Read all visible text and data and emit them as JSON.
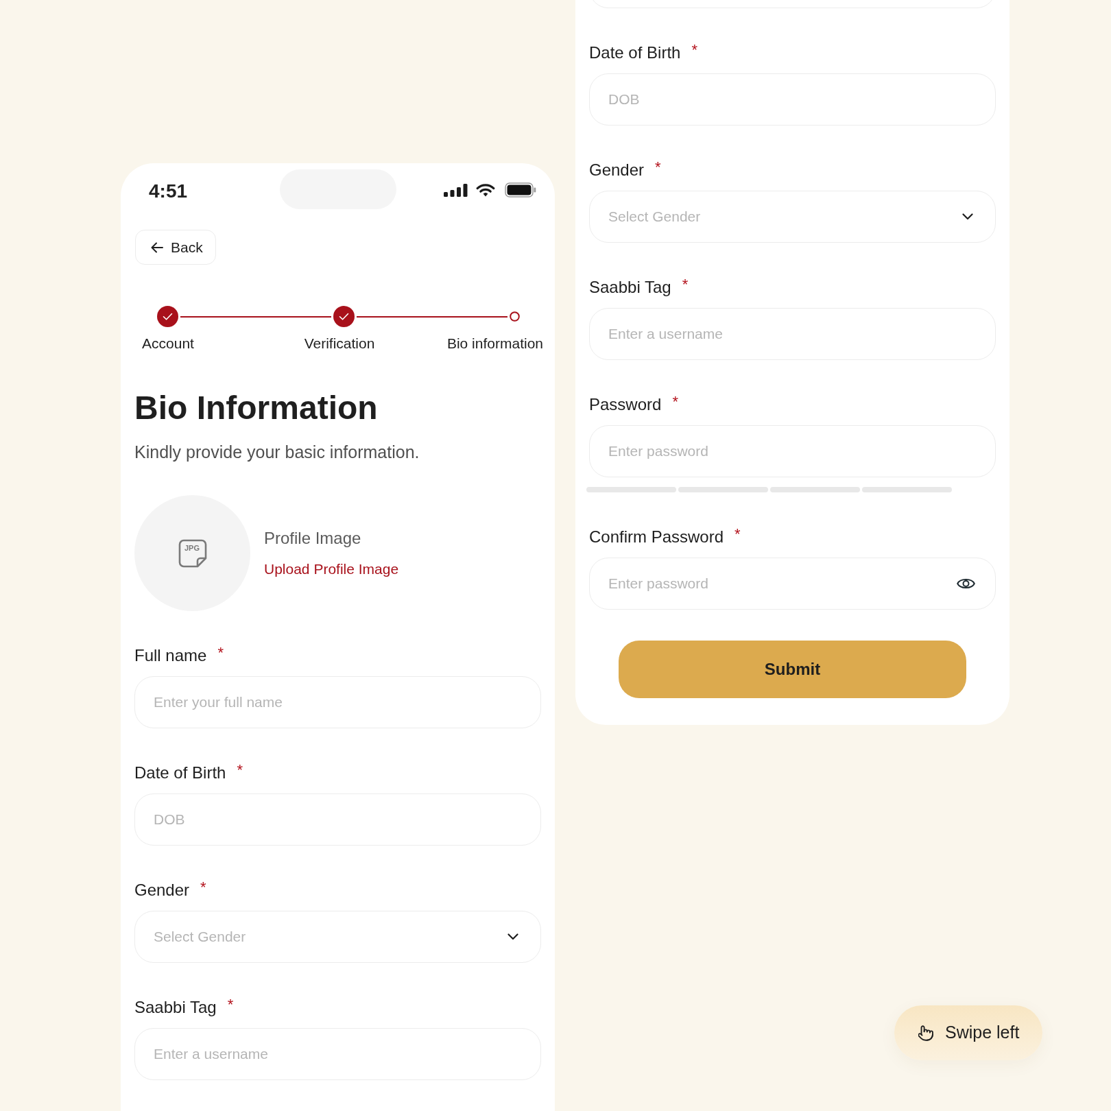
{
  "phone": {
    "status_bar": {
      "time": "4:51"
    },
    "back_button": {
      "label": "Back"
    },
    "steps": [
      {
        "label": "Account",
        "done": true
      },
      {
        "label": "Verification",
        "done": true
      },
      {
        "label": "Bio information",
        "done": false
      }
    ],
    "title": "Bio Information",
    "subtitle": "Kindly provide your basic information.",
    "profile_image": {
      "icon_text": "JPG",
      "label": "Profile Image",
      "link": "Upload Profile Image"
    },
    "fields": [
      {
        "label": "Full name",
        "asterisk": "*",
        "kind": "text",
        "placeholder": "Enter your full name"
      },
      {
        "label": "Date of Birth",
        "asterisk": "*",
        "kind": "text",
        "placeholder": "DOB"
      },
      {
        "label": "Gender",
        "asterisk": "*",
        "kind": "select",
        "placeholder": "Select Gender"
      },
      {
        "label": "Saabbi Tag",
        "asterisk": "*",
        "kind": "text",
        "placeholder": "Enter a username"
      }
    ]
  },
  "continued_screen": {
    "fields": [
      {
        "label": "Date of Birth",
        "asterisk": "*",
        "kind": "text",
        "placeholder": "DOB"
      },
      {
        "label": "Gender",
        "asterisk": "*",
        "kind": "select",
        "placeholder": "Select Gender"
      },
      {
        "label": "Saabbi Tag",
        "asterisk": "*",
        "kind": "text",
        "placeholder": "Enter a username"
      },
      {
        "label": "Password",
        "asterisk": "*",
        "kind": "metered",
        "placeholder": "Enter password",
        "strength_segments": [
          {
            "on": false
          },
          {
            "on": false
          },
          {
            "on": false
          },
          {
            "on": false
          }
        ]
      },
      {
        "label": "Confirm Password",
        "asterisk": "*",
        "kind": "revealable",
        "placeholder": "Enter password"
      }
    ],
    "submit_button": {
      "label": "Submit"
    }
  },
  "swipe_hint": {
    "label": "Swipe left"
  }
}
